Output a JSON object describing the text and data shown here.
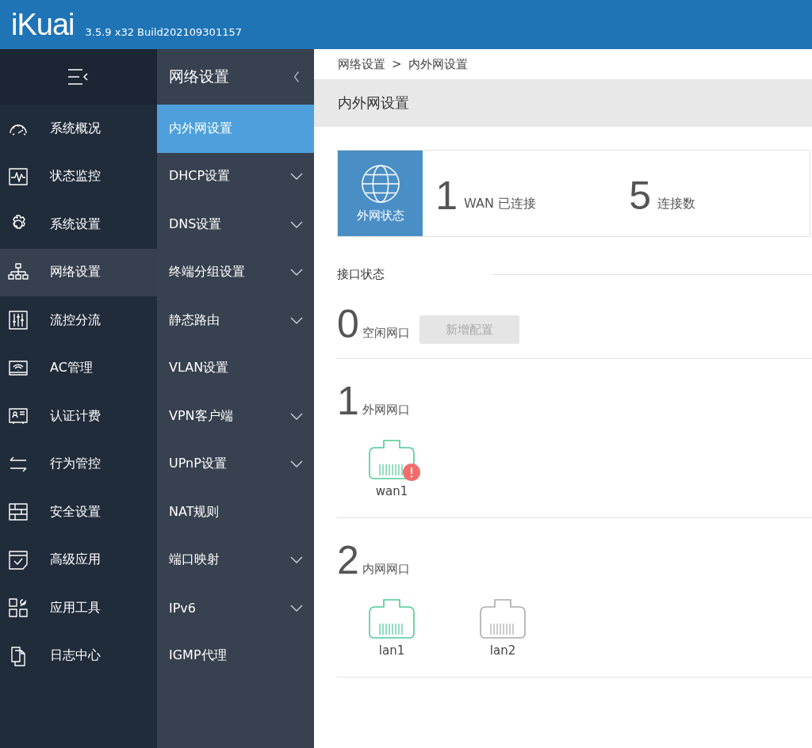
{
  "header": {
    "logo": "iKuai",
    "version": "3.5.9 x32 Build202109301157"
  },
  "sidebar": {
    "items": [
      {
        "label": "系统概况",
        "selected": false
      },
      {
        "label": "状态监控",
        "selected": false
      },
      {
        "label": "系统设置",
        "selected": false
      },
      {
        "label": "网络设置",
        "selected": true
      },
      {
        "label": "流控分流",
        "selected": false
      },
      {
        "label": "AC管理",
        "selected": false
      },
      {
        "label": "认证计费",
        "selected": false
      },
      {
        "label": "行为管控",
        "selected": false
      },
      {
        "label": "安全设置",
        "selected": false
      },
      {
        "label": "高级应用",
        "selected": false
      },
      {
        "label": "应用工具",
        "selected": false
      },
      {
        "label": "日志中心",
        "selected": false
      }
    ]
  },
  "submenu": {
    "title": "网络设置",
    "items": [
      {
        "label": "内外网设置",
        "selected": true,
        "expandable": false
      },
      {
        "label": "DHCP设置",
        "selected": false,
        "expandable": true
      },
      {
        "label": "DNS设置",
        "selected": false,
        "expandable": true
      },
      {
        "label": "终端分组设置",
        "selected": false,
        "expandable": true
      },
      {
        "label": "静态路由",
        "selected": false,
        "expandable": true
      },
      {
        "label": "VLAN设置",
        "selected": false,
        "expandable": false
      },
      {
        "label": "VPN客户端",
        "selected": false,
        "expandable": true
      },
      {
        "label": "UPnP设置",
        "selected": false,
        "expandable": true
      },
      {
        "label": "NAT规则",
        "selected": false,
        "expandable": false
      },
      {
        "label": "端口映射",
        "selected": false,
        "expandable": true
      },
      {
        "label": "IPv6",
        "selected": false,
        "expandable": true
      },
      {
        "label": "IGMP代理",
        "selected": false,
        "expandable": false
      }
    ]
  },
  "breadcrumb": {
    "parent": "网络设置",
    "separator": ">",
    "current": "内外网设置"
  },
  "page_title": "内外网设置",
  "wan_status": {
    "label": "外网状态",
    "stats": [
      {
        "value": "1",
        "label": "WAN 已连接"
      },
      {
        "value": "5",
        "label": "连接数"
      }
    ]
  },
  "interface_status": {
    "title": "接口状态",
    "groups": [
      {
        "count": "0",
        "label": "空闲网口",
        "button": "新增配置"
      },
      {
        "count": "1",
        "label": "外网网口",
        "ports": [
          {
            "name": "wan1",
            "connected": true,
            "alert": true
          }
        ]
      },
      {
        "count": "2",
        "label": "内网网口",
        "ports": [
          {
            "name": "lan1",
            "connected": true,
            "alert": false
          },
          {
            "name": "lan2",
            "connected": false,
            "alert": false
          }
        ]
      }
    ]
  }
}
